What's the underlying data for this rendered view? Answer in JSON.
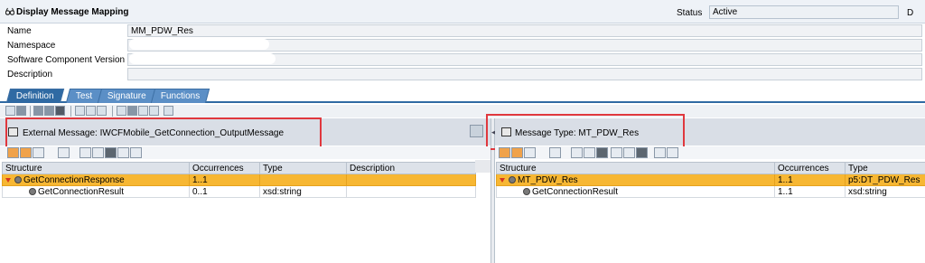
{
  "window": {
    "title": "Display Message Mapping",
    "status_label": "Status",
    "status_value": "Active",
    "status_extra": "D"
  },
  "form": {
    "name_label": "Name",
    "name_value": "MM_PDW_Res",
    "namespace_label": "Namespace",
    "namespace_value": "",
    "swcv_label": "Software Component Version",
    "swcv_value": "",
    "description_label": "Description",
    "description_value": ""
  },
  "tabs": [
    {
      "label": "Definition",
      "active": true
    },
    {
      "label": "Test",
      "active": false
    },
    {
      "label": "Signature",
      "active": false
    },
    {
      "label": "Functions",
      "active": false
    }
  ],
  "left_pane": {
    "title": "External Message: IWCFMobile_GetConnection_OutputMessage",
    "columns": [
      "Structure",
      "Occurrences",
      "Type",
      "Description"
    ],
    "rows": [
      {
        "structure": "GetConnectionResponse",
        "occurrences": "1..1",
        "type": "",
        "description": "",
        "selected": true,
        "expandable": true
      },
      {
        "structure": "GetConnectionResult",
        "occurrences": "0..1",
        "type": "xsd:string",
        "description": "",
        "selected": false,
        "expandable": false
      }
    ]
  },
  "right_pane": {
    "title": "Message Type: MT_PDW_Res",
    "columns": [
      "Structure",
      "Occurrences",
      "Type"
    ],
    "rows": [
      {
        "structure": "MT_PDW_Res",
        "occurrences": "1..1",
        "type": "p5:DT_PDW_Res",
        "selected": true,
        "expandable": true
      },
      {
        "structure": "GetConnectionResult",
        "occurrences": "1..1",
        "type": "xsd:string",
        "selected": false,
        "expandable": false
      }
    ]
  },
  "colors": {
    "tab_active": "#2f6aa3",
    "tab": "#5b8fc6",
    "selection": "#f7b733",
    "highlight_box": "#e0383e"
  }
}
